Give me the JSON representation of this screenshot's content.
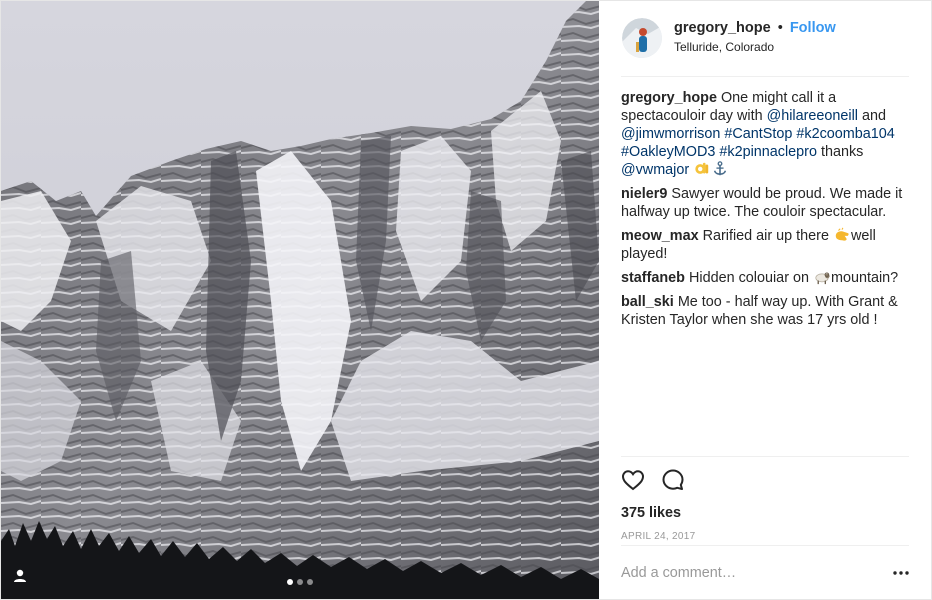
{
  "header": {
    "username": "gregory_hope",
    "separator": "•",
    "follow_label": "Follow",
    "location": "Telluride, Colorado"
  },
  "caption": {
    "author": "gregory_hope",
    "text_1": "One might call it a spectacouloir day with ",
    "mention_1": "@hilareeoneill",
    "text_2": " and ",
    "mention_2": "@jimwmorrison",
    "hashtag_1": "#CantStop",
    "hashtag_2": "#k2coomba104",
    "hashtag_3": "#OakleyMOD3",
    "hashtag_4": "#k2pinnaclepro",
    "text_3": " thanks ",
    "mention_3": "@vwmajor",
    "emojis": [
      "ok-hand",
      "anchor"
    ]
  },
  "comments": [
    {
      "author": "nieler9",
      "text": "Sawyer would be proud. We made it halfway up twice. The couloir spectacular."
    },
    {
      "author": "meow_max",
      "text_before": "Rarified air up there ",
      "emoji": "clapping-hands",
      "text_after": "well played!"
    },
    {
      "author": "staffaneb",
      "text_before": "Hidden colouiar on ",
      "emoji": "ram",
      "text_after": "mountain?"
    },
    {
      "author": "ball_ski",
      "text": "Me too - half way up. With Grant & Kristen Taylor when she was 17 yrs old !"
    }
  ],
  "actions": {
    "like_icon": "heart-icon",
    "comment_icon": "comment-icon",
    "likes": "375 likes",
    "date": "APRIL 24, 2017"
  },
  "add_comment": {
    "placeholder": "Add a comment…",
    "more_icon": "more-options-icon"
  },
  "carousel": {
    "slide_count": 3,
    "active_slide": 1
  },
  "colors": {
    "accent": "#3897f0",
    "link": "#003569",
    "muted": "#999999",
    "border": "#efefef"
  }
}
